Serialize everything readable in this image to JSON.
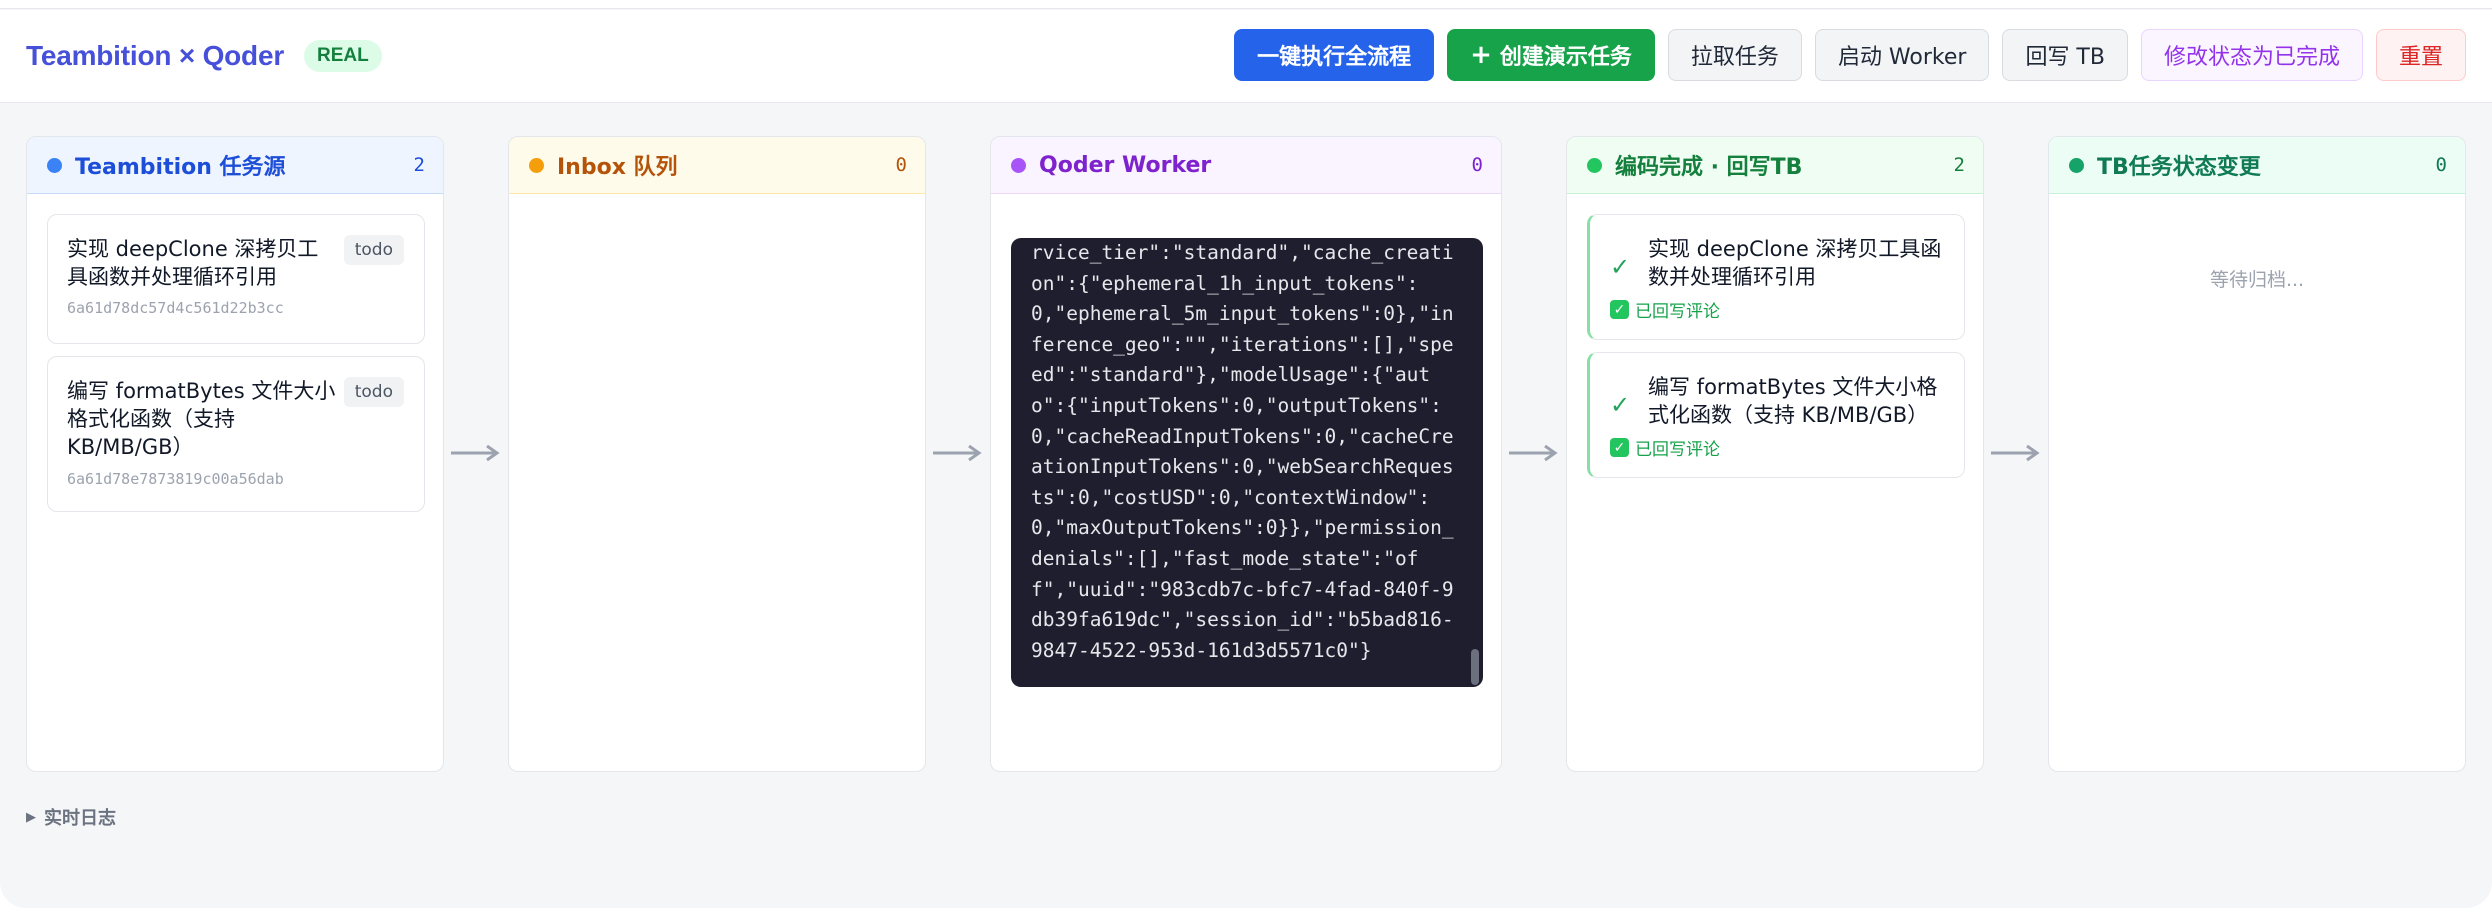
{
  "header": {
    "title": "Teambition × Qoder",
    "mode_badge": "REAL",
    "buttons": {
      "run_all": "一键执行全流程",
      "create_demo": "创建演示任务",
      "pull_tasks": "拉取任务",
      "start_worker": "启动 Worker",
      "write_back": "回写 TB",
      "mark_done": "修改状态为已完成",
      "reset": "重置"
    }
  },
  "columns": {
    "source": {
      "title": "Teambition 任务源",
      "count": "2",
      "tasks": [
        {
          "name": "实现 deepClone 深拷贝工具函数并处理循环引用",
          "status": "todo",
          "id": "6a61d78dc57d4c561d22b3cc"
        },
        {
          "name": "编写 formatBytes 文件大小格式化函数（支持 KB/MB/GB）",
          "status": "todo",
          "id": "6a61d78e7873819c00a56dab"
        }
      ]
    },
    "inbox": {
      "title": "Inbox 队列",
      "count": "0"
    },
    "worker": {
      "title": "Qoder Worker",
      "count": "0",
      "log": "rvice_tier\":\"standard\",\"cache_creation\":{\"ephemeral_1h_input_tokens\":0,\"ephemeral_5m_input_tokens\":0},\"inference_geo\":\"\",\"iterations\":[],\"speed\":\"standard\"},\"modelUsage\":{\"auto\":{\"inputTokens\":0,\"outputTokens\":0,\"cacheReadInputTokens\":0,\"cacheCreationInputTokens\":0,\"webSearchRequests\":0,\"costUSD\":0,\"contextWindow\":0,\"maxOutputTokens\":0}},\"permission_denials\":[],\"fast_mode_state\":\"off\",\"uuid\":\"983cdb7c-bfc7-4fad-840f-9db39fa619dc\",\"session_id\":\"b5bad816-9847-4522-953d-161d3d5571c0\"}"
    },
    "done": {
      "title": "编码完成 · 回写TB",
      "count": "2",
      "tasks": [
        {
          "name": "实现 deepClone 深拷贝工具函数并处理循环引用",
          "note": "已回写评论"
        },
        {
          "name": "编写 formatBytes 文件大小格式化函数（支持 KB/MB/GB）",
          "note": "已回写评论"
        }
      ]
    },
    "status_change": {
      "title": "TB任务状态变更",
      "count": "0",
      "empty_text": "等待归档..."
    }
  },
  "log_toggle": "实时日志",
  "colors": {
    "brand": "#4650d8",
    "primary": "#2563eb",
    "success": "#16a34a",
    "purple": "#9333ea",
    "danger": "#dc2626",
    "terminal_bg": "#1e1e2e"
  }
}
